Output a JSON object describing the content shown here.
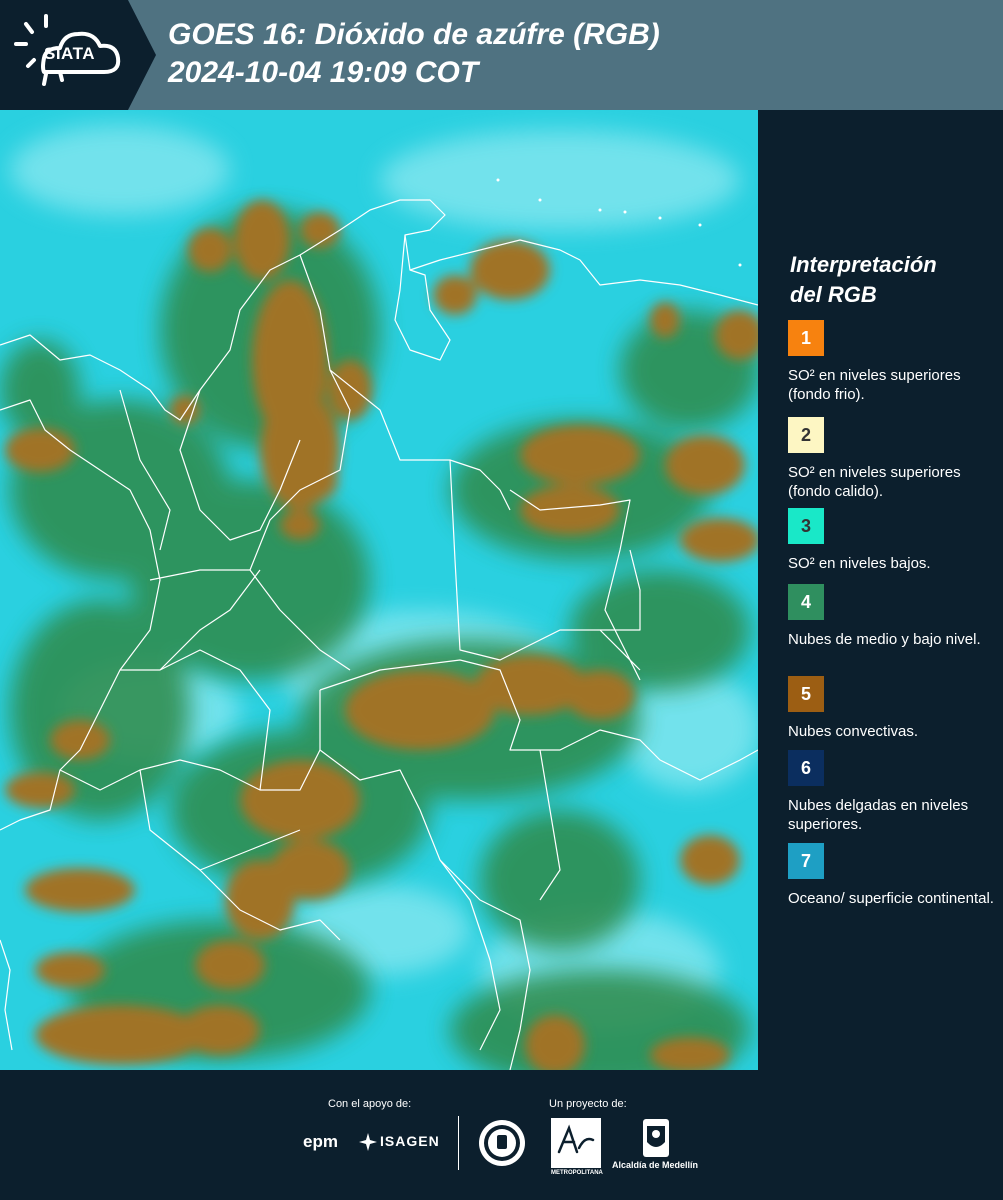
{
  "header": {
    "logo_text": "SIATA",
    "title_line1": "GOES 16: Dióxido de azúfre (RGB)",
    "title_line2": " 2024-10-04 19:09 COT"
  },
  "legend": {
    "title_line1": "Interpretación",
    "title_line2": "del RGB",
    "items": [
      {
        "number": "1",
        "color": "#f7820f",
        "label": "SO² en niveles superiores (fondo frio)."
      },
      {
        "number": "2",
        "color": "#fdf6c3",
        "label": "SO² en niveles superiores (fondo calido)."
      },
      {
        "number": "3",
        "color": "#19e8c8",
        "label": "SO² en niveles bajos."
      },
      {
        "number": "4",
        "color": "#2f8f5f",
        "label": "Nubes de medio y bajo nivel."
      },
      {
        "number": "5",
        "color": "#9c5e13",
        "label": "Nubes convectivas."
      },
      {
        "number": "6",
        "color": "#0b2e5f",
        "label": "Nubes delgadas en niveles superiores."
      },
      {
        "number": "7",
        "color": "#1e9fc4",
        "label": "Oceano/ superficie continental."
      }
    ]
  },
  "footer": {
    "support_label": "Con el apoyo de:",
    "project_label": "Un proyecto de:",
    "sponsor1": "epm",
    "sponsor2": "ISAGEN",
    "partner_area": "METROPOLITANA",
    "partner_alcaldia": "Alcaldía de Medellín"
  },
  "map": {
    "colors": {
      "background": "#2ad0e0",
      "haze": "#7fe6ef",
      "convective": "#a07327",
      "midlevel": "#2d8a4a",
      "border": "#ffffff"
    }
  }
}
